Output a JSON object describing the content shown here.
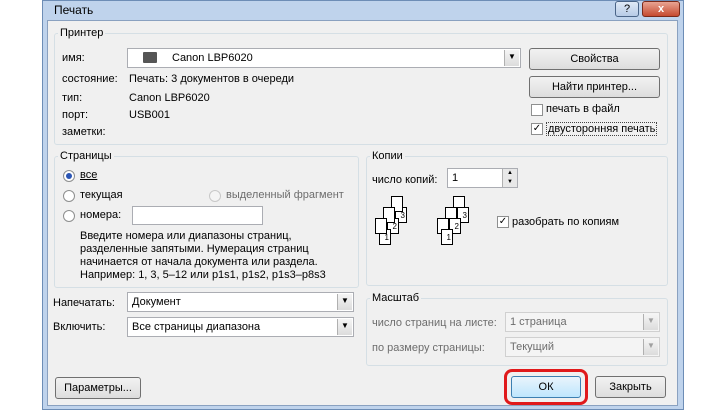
{
  "window": {
    "title": "Печать",
    "help_btn": "?",
    "close_btn": "x"
  },
  "printer": {
    "group_label": "Принтер",
    "name_label": "имя:",
    "name_value": "Canon LBP6020",
    "status_label": "состояние:",
    "status_value": "Печать: 3 документов в очереди",
    "type_label": "тип:",
    "type_value": "Canon LBP6020",
    "port_label": "порт:",
    "port_value": "USB001",
    "notes_label": "заметки:",
    "properties_btn": "Свойства",
    "find_printer_btn": "Найти принтер...",
    "print_to_file": {
      "label": "печать в файл",
      "checked": false
    },
    "duplex": {
      "label": "двусторонняя печать",
      "checked": true
    }
  },
  "pages": {
    "group_label": "Страницы",
    "all": "все",
    "current": "текущая",
    "selection": "выделенный фрагмент",
    "numbers": "номера:",
    "numbers_value": "",
    "hint_line1": "Введите номера или диапазоны страниц,",
    "hint_line2": "разделенные запятыми. Нумерация страниц",
    "hint_line3": "начинается от начала документа или раздела.",
    "hint_line4": "Например: 1, 3, 5–12 или p1s1, p1s2, p1s3–p8s3"
  },
  "copies": {
    "group_label": "Копии",
    "count_label": "число копий:",
    "count_value": "1",
    "collate": {
      "label": "разобрать по копиям",
      "checked": true
    },
    "page_numbers": [
      "1",
      "2",
      "3"
    ]
  },
  "print_what": {
    "label": "Напечатать:",
    "value": "Документ"
  },
  "include": {
    "label": "Включить:",
    "value": "Все страницы диапазона"
  },
  "zoom": {
    "group_label": "Масштаб",
    "pages_per_sheet_label": "число страниц на листе:",
    "pages_per_sheet_value": "1 страница",
    "scale_label": "по размеру страницы:",
    "scale_value": "Текущий"
  },
  "footer": {
    "options_btn": "Параметры...",
    "ok_btn": "ОК",
    "close_btn": "Закрыть"
  },
  "colors": {
    "highlight": "#e0191b",
    "title_bg": "#bfd3ec",
    "dialog_bg": "#f0f0f0"
  }
}
